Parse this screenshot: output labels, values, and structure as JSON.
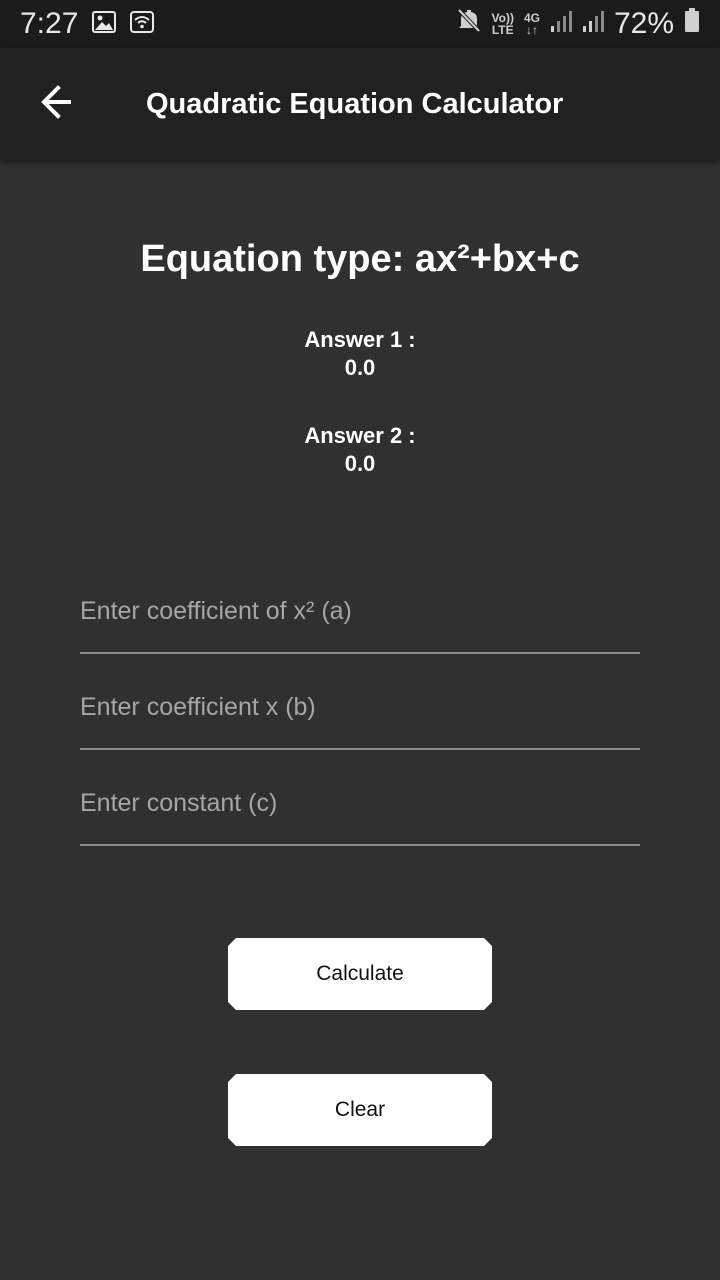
{
  "status_bar": {
    "time": "7:27",
    "battery": "72%",
    "network_top": "Vo))",
    "network_bottom": "LTE",
    "net_4g": "4G",
    "net_arrows": "↓↑",
    "icons": [
      "image-icon",
      "wifi-icon",
      "mute-icon",
      "signal-icon",
      "battery-icon"
    ]
  },
  "app_bar": {
    "title": "Quadratic Equation Calculator",
    "back_icon": "arrow-left-icon"
  },
  "main": {
    "equation_type": "Equation type: ax²+bx+c",
    "answer1_label": "Answer 1 :",
    "answer1_value": "0.0",
    "answer2_label": "Answer 2 :",
    "answer2_value": "0.0"
  },
  "inputs": {
    "a_placeholder": "Enter coefficient of x² (a)",
    "a_value": "",
    "b_placeholder": "Enter coefficient x (b)",
    "b_value": "",
    "c_placeholder": "Enter constant (c)",
    "c_value": ""
  },
  "buttons": {
    "calculate": "Calculate",
    "clear": "Clear"
  },
  "colors": {
    "background": "#303030",
    "app_bar": "#212121",
    "status_bar": "#1b1b1b",
    "button_bg": "#ffffff"
  }
}
